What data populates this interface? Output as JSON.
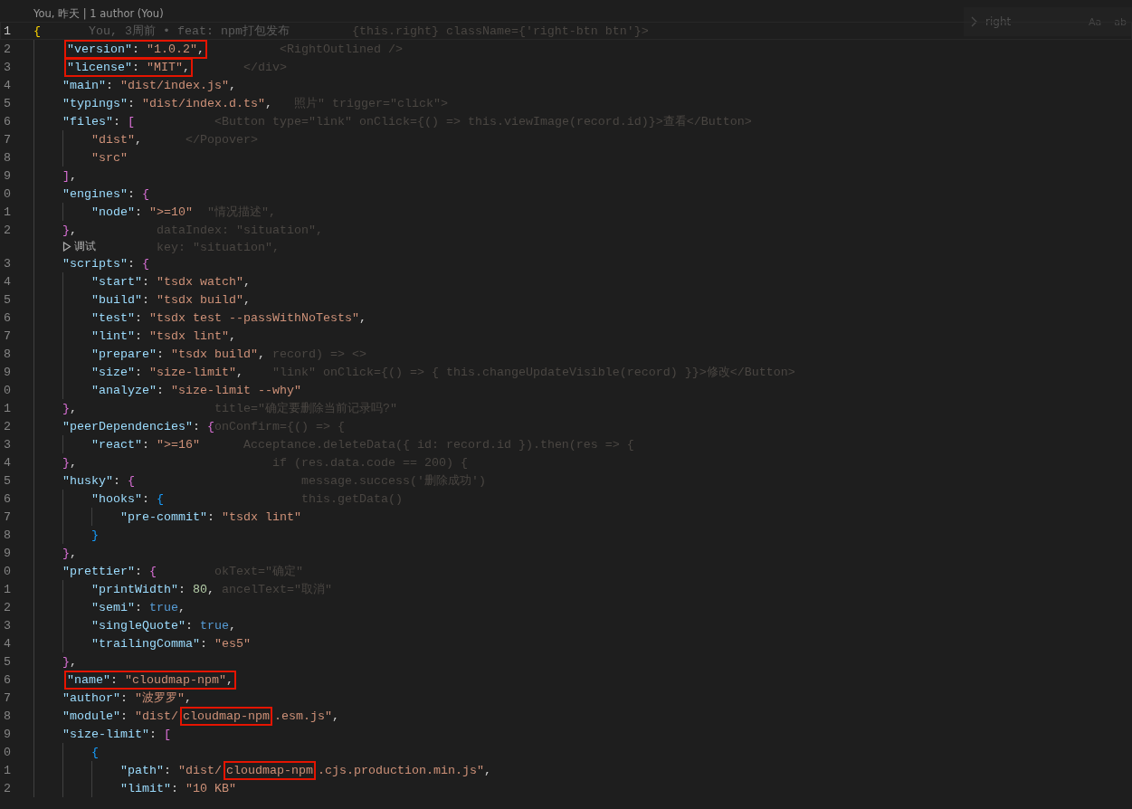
{
  "find_widget": {
    "query": "right",
    "options": [
      "Aa",
      "ab"
    ]
  },
  "rows": [
    {
      "kind": "author_lens",
      "text": "You, 昨天 | 1 author (You)"
    },
    {
      "kind": "code",
      "number": "1",
      "current": true,
      "tokens": [
        {
          "kind": "bracket_a",
          "text": "{"
        }
      ],
      "blame": "You, 3周前 • feat: npm打包发布",
      "ghost": "                                            {this.right} className={'right-btn btn'}>",
      "children": [
        {
          "kind": "code",
          "number": "2",
          "current": false,
          "tokens": [
            {
              "kind": "key",
              "text": "\"version\"",
              "boxed": true
            },
            {
              "kind": "punct",
              "text": ": ",
              "boxed": true
            },
            {
              "kind": "string",
              "text": "\"1.0.2\"",
              "boxed": true
            },
            {
              "kind": "punct",
              "text": ",",
              "boxed": true
            }
          ],
          "ghost": "                                  <RightOutlined />"
        },
        {
          "kind": "code",
          "number": "3",
          "current": false,
          "tokens": [
            {
              "kind": "key",
              "text": "\"license\"",
              "boxed": true
            },
            {
              "kind": "punct",
              "text": ": ",
              "boxed": true
            },
            {
              "kind": "string",
              "text": "\"MIT\"",
              "boxed": true
            },
            {
              "kind": "punct",
              "text": ",",
              "boxed": true
            }
          ],
          "ghost": "                             </div>"
        },
        {
          "kind": "code",
          "number": "4",
          "current": false,
          "tokens": [
            {
              "kind": "key",
              "text": "\"main\""
            },
            {
              "kind": "punct",
              "text": ": "
            },
            {
              "kind": "string",
              "text": "\"dist/index.js\""
            },
            {
              "kind": "punct",
              "text": ","
            }
          ]
        },
        {
          "kind": "code",
          "number": "5",
          "current": false,
          "tokens": [
            {
              "kind": "key",
              "text": "\"typings\""
            },
            {
              "kind": "punct",
              "text": ": "
            },
            {
              "kind": "string",
              "text": "\"dist/index.d.ts\""
            },
            {
              "kind": "punct",
              "text": ","
            }
          ],
          "ghost": "                                    照片\" trigger=\"click\">"
        },
        {
          "kind": "code",
          "number": "6",
          "current": false,
          "tokens": [
            {
              "kind": "key",
              "text": "\"files\""
            },
            {
              "kind": "punct",
              "text": ": "
            },
            {
              "kind": "bracket_b",
              "text": "["
            }
          ],
          "ghost": "                         <Button type=\"link\" onClick={() => this.viewImage(record.id)}>查看</Button>",
          "children": [
            {
              "kind": "code",
              "number": "7",
              "current": false,
              "tokens": [
                {
                  "kind": "string",
                  "text": "\"dist\""
                },
                {
                  "kind": "punct",
                  "text": ","
                }
              ],
              "ghost": "                     </Popover>"
            },
            {
              "kind": "code",
              "number": "8",
              "current": false,
              "tokens": [
                {
                  "kind": "string",
                  "text": "\"src\""
                }
              ]
            }
          ]
        },
        {
          "kind": "code",
          "number": "9",
          "current": false,
          "tokens": [
            {
              "kind": "bracket_b",
              "text": "]"
            },
            {
              "kind": "punct",
              "text": ","
            }
          ]
        },
        {
          "kind": "code",
          "number": "0",
          "current": false,
          "tokens": [
            {
              "kind": "key",
              "text": "\"engines\""
            },
            {
              "kind": "punct",
              "text": ": "
            },
            {
              "kind": "bracket_b",
              "text": "{"
            }
          ],
          "children": [
            {
              "kind": "code",
              "number": "1",
              "current": false,
              "tokens": [
                {
                  "kind": "key",
                  "text": "\"node\""
                },
                {
                  "kind": "punct",
                  "text": ": "
                },
                {
                  "kind": "string",
                  "text": "\">=10\""
                }
              ],
              "ghost": "                        \"情况描述\","
            }
          ]
        },
        {
          "kind": "code",
          "number": "2",
          "current": false,
          "tokens": [
            {
              "kind": "bracket_b",
              "text": "}"
            },
            {
              "kind": "punct",
              "text": ","
            }
          ],
          "ghost": "                 dataIndex: \"situation\","
        },
        {
          "kind": "debug_lens",
          "text": "调试",
          "ghost": "                 key: \"situation\","
        },
        {
          "kind": "code",
          "number": "3",
          "current": false,
          "tokens": [
            {
              "kind": "key",
              "text": "\"scripts\""
            },
            {
              "kind": "punct",
              "text": ": "
            },
            {
              "kind": "bracket_b",
              "text": "{"
            }
          ],
          "children": [
            {
              "kind": "code",
              "number": "4",
              "current": false,
              "tokens": [
                {
                  "kind": "key",
                  "text": "\"start\""
                },
                {
                  "kind": "punct",
                  "text": ": "
                },
                {
                  "kind": "string",
                  "text": "\"tsdx watch\""
                },
                {
                  "kind": "punct",
                  "text": ","
                }
              ]
            },
            {
              "kind": "code",
              "number": "5",
              "current": false,
              "tokens": [
                {
                  "kind": "key",
                  "text": "\"build\""
                },
                {
                  "kind": "punct",
                  "text": ": "
                },
                {
                  "kind": "string",
                  "text": "\"tsdx build\""
                },
                {
                  "kind": "punct",
                  "text": ","
                }
              ]
            },
            {
              "kind": "code",
              "number": "6",
              "current": false,
              "tokens": [
                {
                  "kind": "key",
                  "text": "\"test\""
                },
                {
                  "kind": "punct",
                  "text": ": "
                },
                {
                  "kind": "string",
                  "text": "\"tsdx test --passWithNoTests\""
                },
                {
                  "kind": "punct",
                  "text": ","
                }
              ]
            },
            {
              "kind": "code",
              "number": "7",
              "current": false,
              "tokens": [
                {
                  "kind": "key",
                  "text": "\"lint\""
                },
                {
                  "kind": "punct",
                  "text": ": "
                },
                {
                  "kind": "string",
                  "text": "\"tsdx lint\""
                },
                {
                  "kind": "punct",
                  "text": ","
                }
              ]
            },
            {
              "kind": "code",
              "number": "8",
              "current": false,
              "tokens": [
                {
                  "kind": "key",
                  "text": "\"prepare\""
                },
                {
                  "kind": "punct",
                  "text": ": "
                },
                {
                  "kind": "string",
                  "text": "\"tsdx build\""
                },
                {
                  "kind": "punct",
                  "text": ","
                }
              ],
              "ghost": "                                 record) => <>"
            },
            {
              "kind": "code",
              "number": "9",
              "current": false,
              "tokens": [
                {
                  "kind": "key",
                  "text": "\"size\""
                },
                {
                  "kind": "punct",
                  "text": ": "
                },
                {
                  "kind": "string",
                  "text": "\"size-limit\""
                },
                {
                  "kind": "punct",
                  "text": ","
                }
              ],
              "ghost": "                                 \"link\" onClick={() => { this.changeUpdateVisible(record) }}>修改</Button>"
            },
            {
              "kind": "code",
              "number": "0",
              "current": false,
              "tokens": [
                {
                  "kind": "key",
                  "text": "\"analyze\""
                },
                {
                  "kind": "punct",
                  "text": ": "
                },
                {
                  "kind": "string",
                  "text": "\"size-limit --why\""
                }
              ]
            }
          ]
        },
        {
          "kind": "code",
          "number": "1",
          "current": false,
          "tokens": [
            {
              "kind": "bracket_b",
              "text": "}"
            },
            {
              "kind": "punct",
              "text": ","
            }
          ],
          "ghost": "                         title=\"确定要删除当前记录吗?\""
        },
        {
          "kind": "code",
          "number": "2",
          "current": false,
          "tokens": [
            {
              "kind": "key",
              "text": "\"peerDependencies\""
            },
            {
              "kind": "punct",
              "text": ": "
            },
            {
              "kind": "bracket_b",
              "text": "{"
            }
          ],
          "ghost": "                         onConfirm={() => {",
          "children": [
            {
              "kind": "code",
              "number": "3",
              "current": false,
              "tokens": [
                {
                  "kind": "key",
                  "text": "\"react\""
                },
                {
                  "kind": "punct",
                  "text": ": "
                },
                {
                  "kind": "string",
                  "text": "\">=16\""
                }
              ],
              "ghost": "                             Acceptance.deleteData({ id: record.id }).then(res => {"
            }
          ]
        },
        {
          "kind": "code",
          "number": "4",
          "current": false,
          "tokens": [
            {
              "kind": "bracket_b",
              "text": "}"
            },
            {
              "kind": "punct",
              "text": ","
            }
          ],
          "ghost": "                                 if (res.data.code == 200) {"
        },
        {
          "kind": "code",
          "number": "5",
          "current": false,
          "tokens": [
            {
              "kind": "key",
              "text": "\"husky\""
            },
            {
              "kind": "punct",
              "text": ": "
            },
            {
              "kind": "bracket_b",
              "text": "{"
            }
          ],
          "ghost": "                                     message.success('删除成功')",
          "children": [
            {
              "kind": "code",
              "number": "6",
              "current": false,
              "tokens": [
                {
                  "kind": "key",
                  "text": "\"hooks\""
                },
                {
                  "kind": "punct",
                  "text": ": "
                },
                {
                  "kind": "bracket_c",
                  "text": "{"
                }
              ],
              "ghost": "                                     this.getData()",
              "children": [
                {
                  "kind": "code",
                  "number": "7",
                  "current": false,
                  "tokens": [
                    {
                      "kind": "key",
                      "text": "\"pre-commit\""
                    },
                    {
                      "kind": "punct",
                      "text": ": "
                    },
                    {
                      "kind": "string",
                      "text": "\"tsdx lint\""
                    }
                  ]
                }
              ]
            },
            {
              "kind": "code",
              "number": "8",
              "current": false,
              "tokens": [
                {
                  "kind": "bracket_c",
                  "text": "}"
                }
              ]
            }
          ]
        },
        {
          "kind": "code",
          "number": "9",
          "current": false,
          "tokens": [
            {
              "kind": "bracket_b",
              "text": "}"
            },
            {
              "kind": "punct",
              "text": ","
            }
          ]
        },
        {
          "kind": "code",
          "number": "0",
          "current": false,
          "tokens": [
            {
              "kind": "key",
              "text": "\"prettier\""
            },
            {
              "kind": "punct",
              "text": ": "
            },
            {
              "kind": "bracket_b",
              "text": "{"
            }
          ],
          "ghost": "                         okText=\"确定\"",
          "children": [
            {
              "kind": "code",
              "number": "1",
              "current": false,
              "tokens": [
                {
                  "kind": "key",
                  "text": "\"printWidth\""
                },
                {
                  "kind": "punct",
                  "text": ": "
                },
                {
                  "kind": "number",
                  "text": "80"
                },
                {
                  "kind": "punct",
                  "text": ","
                }
              ],
              "ghost": "                          ancelText=\"取消\""
            },
            {
              "kind": "code",
              "number": "2",
              "current": false,
              "tokens": [
                {
                  "kind": "key",
                  "text": "\"semi\""
                },
                {
                  "kind": "punct",
                  "text": ": "
                },
                {
                  "kind": "keyword",
                  "text": "true"
                },
                {
                  "kind": "punct",
                  "text": ","
                }
              ]
            },
            {
              "kind": "code",
              "number": "3",
              "current": false,
              "tokens": [
                {
                  "kind": "key",
                  "text": "\"singleQuote\""
                },
                {
                  "kind": "punct",
                  "text": ": "
                },
                {
                  "kind": "keyword",
                  "text": "true"
                },
                {
                  "kind": "punct",
                  "text": ","
                }
              ]
            },
            {
              "kind": "code",
              "number": "4",
              "current": false,
              "tokens": [
                {
                  "kind": "key",
                  "text": "\"trailingComma\""
                },
                {
                  "kind": "punct",
                  "text": ": "
                },
                {
                  "kind": "string",
                  "text": "\"es5\""
                }
              ]
            }
          ]
        },
        {
          "kind": "code",
          "number": "5",
          "current": false,
          "tokens": [
            {
              "kind": "bracket_b",
              "text": "}"
            },
            {
              "kind": "punct",
              "text": ","
            }
          ]
        },
        {
          "kind": "code",
          "number": "6",
          "current": false,
          "tokens": [
            {
              "kind": "key",
              "text": "\"name\"",
              "boxed": true
            },
            {
              "kind": "punct",
              "text": ": ",
              "boxed": true
            },
            {
              "kind": "string",
              "text": "\"cloudmap-npm\"",
              "boxed": true
            },
            {
              "kind": "punct",
              "text": ",",
              "boxed": true
            }
          ]
        },
        {
          "kind": "code",
          "number": "7",
          "current": false,
          "tokens": [
            {
              "kind": "key",
              "text": "\"author\""
            },
            {
              "kind": "punct",
              "text": ": "
            },
            {
              "kind": "string",
              "text": "\"波罗罗\""
            },
            {
              "kind": "punct",
              "text": ","
            }
          ]
        },
        {
          "kind": "code",
          "number": "8",
          "current": false,
          "tokens": [
            {
              "kind": "key",
              "text": "\"module\""
            },
            {
              "kind": "punct",
              "text": ": "
            },
            {
              "kind": "string",
              "text": "\"dist/"
            },
            {
              "kind": "string",
              "text": "cloudmap-npm",
              "boxed": true
            },
            {
              "kind": "string",
              "text": ".esm.js\""
            },
            {
              "kind": "punct",
              "text": ","
            }
          ]
        },
        {
          "kind": "code",
          "number": "9",
          "current": false,
          "tokens": [
            {
              "kind": "key",
              "text": "\"size-limit\""
            },
            {
              "kind": "punct",
              "text": ": "
            },
            {
              "kind": "bracket_b",
              "text": "["
            }
          ],
          "children": [
            {
              "kind": "code",
              "number": "0",
              "current": false,
              "tokens": [
                {
                  "kind": "bracket_c",
                  "text": "{"
                }
              ],
              "children": [
                {
                  "kind": "code",
                  "number": "1",
                  "current": false,
                  "tokens": [
                    {
                      "kind": "key",
                      "text": "\"path\""
                    },
                    {
                      "kind": "punct",
                      "text": ": "
                    },
                    {
                      "kind": "string",
                      "text": "\"dist/"
                    },
                    {
                      "kind": "string",
                      "text": "cloudmap-npm",
                      "boxed": true
                    },
                    {
                      "kind": "string",
                      "text": ".cjs.production.min.js\""
                    },
                    {
                      "kind": "punct",
                      "text": ","
                    }
                  ]
                },
                {
                  "kind": "code",
                  "number": "2",
                  "current": false,
                  "tokens": [
                    {
                      "kind": "key",
                      "text": "\"limit\""
                    },
                    {
                      "kind": "punct",
                      "text": ": "
                    },
                    {
                      "kind": "string",
                      "text": "\"10 KB\""
                    }
                  ]
                }
              ]
            }
          ]
        }
      ]
    }
  ]
}
